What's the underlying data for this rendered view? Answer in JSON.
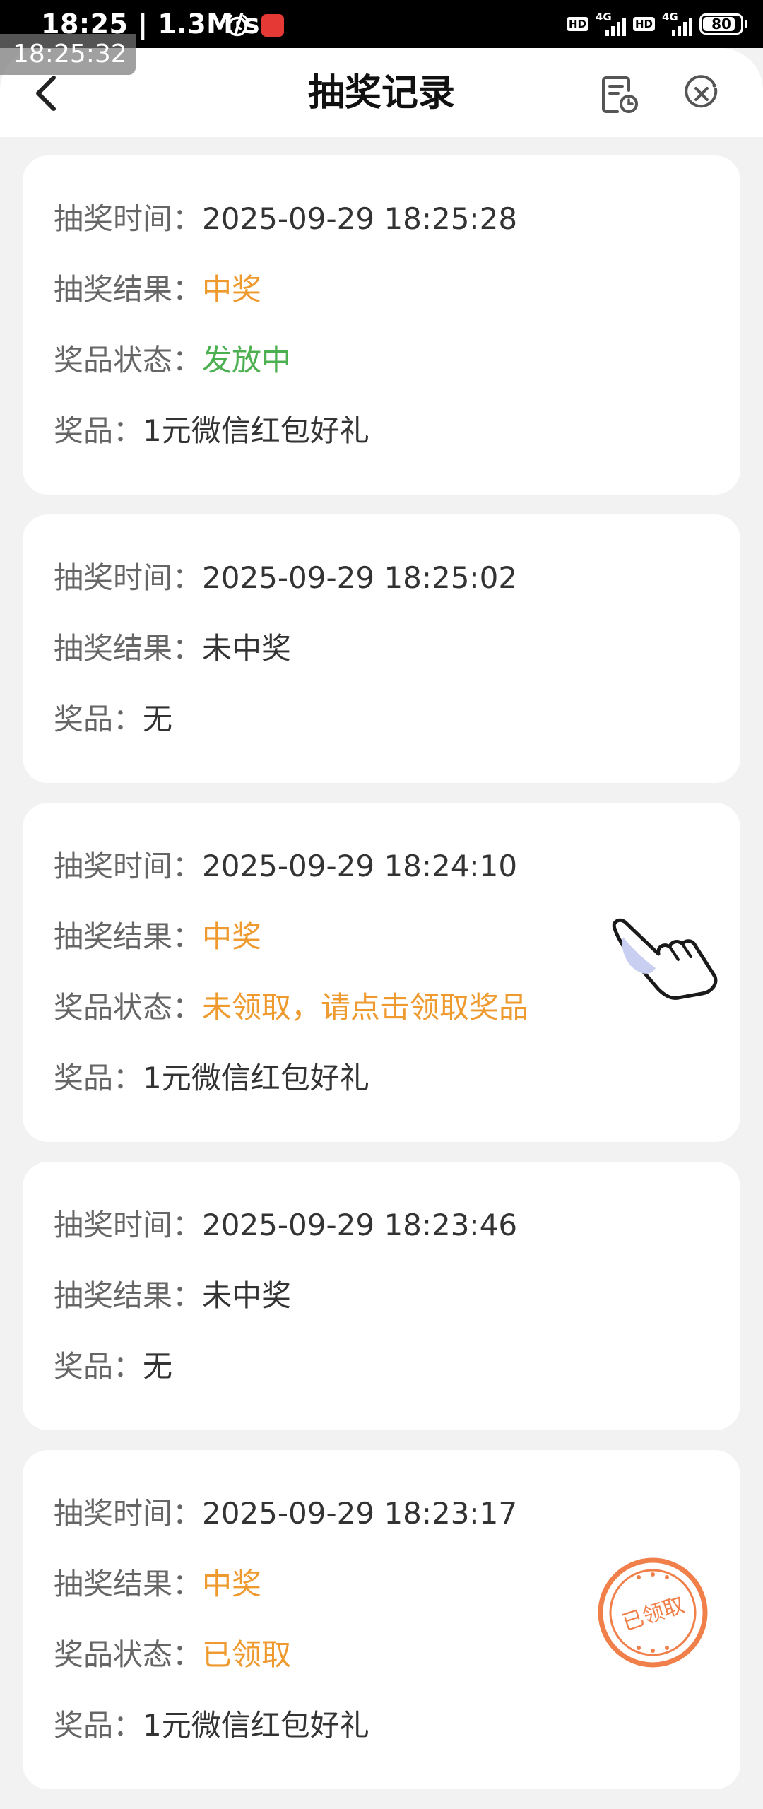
{
  "status_bar": {
    "time": "18:25",
    "speed": "1.3M/s",
    "hd1": "HD",
    "net1": "4G",
    "hd2": "HD",
    "net2": "4G",
    "battery": "80"
  },
  "overlay_clock": "18:25:32",
  "header": {
    "title": "抽奖记录"
  },
  "labels": {
    "time": "抽奖时间：",
    "result": "抽奖结果：",
    "status": "奖品状态：",
    "prize": "奖品："
  },
  "records": [
    {
      "time": "2025-09-29 18:25:28",
      "result": "中奖",
      "status": "发放中",
      "prize": "1元微信红包好礼"
    },
    {
      "time": "2025-09-29 18:25:02",
      "result": "未中奖",
      "prize": "无"
    },
    {
      "time": "2025-09-29 18:24:10",
      "result": "中奖",
      "status": "未领取，请点击领取奖品",
      "prize": "1元微信红包好礼"
    },
    {
      "time": "2025-09-29 18:23:46",
      "result": "未中奖",
      "prize": "无"
    },
    {
      "time": "2025-09-29 18:23:17",
      "result": "中奖",
      "status": "已领取",
      "prize": "1元微信红包好礼",
      "stamp": "已领取"
    }
  ],
  "colors": {
    "accent_orange": "#ee9a2f",
    "success_green": "#4caf50",
    "stamp_red": "#f07f4a",
    "background": "#f2f2f2"
  }
}
